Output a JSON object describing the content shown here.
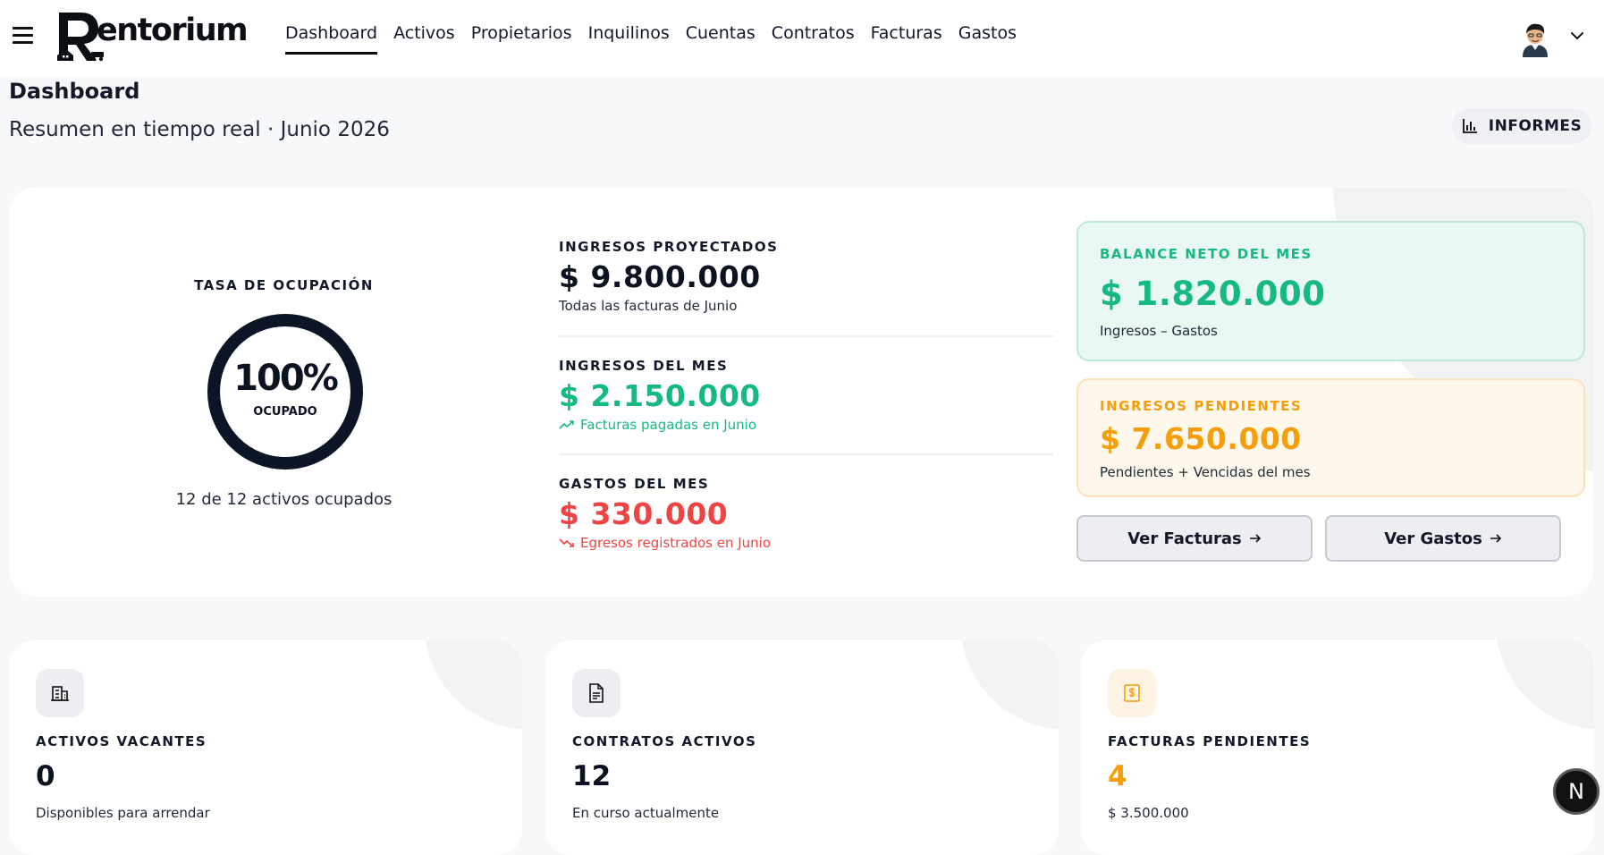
{
  "header": {
    "logo_text": "entorium",
    "nav": [
      "Dashboard",
      "Activos",
      "Propietarios",
      "Inquilinos",
      "Cuentas",
      "Contratos",
      "Facturas",
      "Gastos"
    ]
  },
  "page": {
    "title": "Dashboard",
    "subtitle": "Resumen en tiempo real · Junio 2026",
    "informes_label": "INFORMES"
  },
  "occupancy": {
    "label": "TASA DE OCUPACIÓN",
    "percent": "100%",
    "percent_value": 100,
    "status": "OCUPADO",
    "count_text": "12 de 12 activos ocupados"
  },
  "metrics": [
    {
      "label": "INGRESOS PROYECTADOS",
      "value": "$ 9.800.000",
      "note": "Todas las facturas de Junio",
      "color": "#0b1220"
    },
    {
      "label": "INGRESOS DEL MES",
      "value": "$ 2.150.000",
      "note": "Facturas pagadas en Junio",
      "color": "#16b981"
    },
    {
      "label": "GASTOS DEL MES",
      "value": "$ 330.000",
      "note": "Egresos registrados en Junio",
      "color": "#ef4444"
    }
  ],
  "balance": {
    "label": "BALANCE NETO DEL MES",
    "value": "$ 1.820.000",
    "note": "Ingresos – Gastos",
    "color": "#16b981"
  },
  "pending": {
    "label": "INGRESOS PENDIENTES",
    "value": "$ 7.650.000",
    "note": "Pendientes + Vencidas del mes",
    "color": "#f59e0b"
  },
  "buttons": {
    "facturas": "Ver Facturas",
    "gastos": "Ver Gastos"
  },
  "stats": [
    {
      "label": "ACTIVOS VACANTES",
      "value": "0",
      "note": "Disponibles para arrendar",
      "icon": "building-icon",
      "color": "#0b1220"
    },
    {
      "label": "CONTRATOS ACTIVOS",
      "value": "12",
      "note": "En curso actualmente",
      "icon": "document-icon",
      "color": "#0b1220"
    },
    {
      "label": "FACTURAS PENDIENTES",
      "value": "4",
      "note": "$ 3.500.000",
      "icon": "invoice-dollar-icon",
      "color": "#f59e0b"
    }
  ],
  "badge": "N"
}
